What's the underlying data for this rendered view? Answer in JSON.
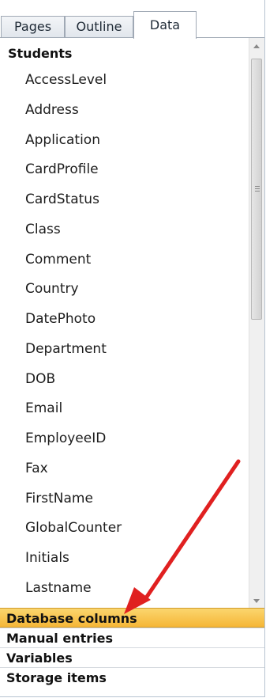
{
  "tabs": [
    {
      "label": "Pages"
    },
    {
      "label": "Outline"
    },
    {
      "label": "Data"
    }
  ],
  "active_tab": "Data",
  "tree": {
    "header": "Students",
    "items": [
      "AccessLevel",
      "Address",
      "Application",
      "CardProfile",
      "CardStatus",
      "Class",
      "Comment",
      "Country",
      "DatePhoto",
      "Department",
      "DOB",
      "Email",
      "EmployeeID",
      "Fax",
      "FirstName",
      "GlobalCounter",
      "Initials",
      "Lastname"
    ]
  },
  "sections": [
    {
      "label": "Database columns",
      "selected": true
    },
    {
      "label": "Manual entries",
      "selected": false
    },
    {
      "label": "Variables",
      "selected": false
    },
    {
      "label": "Storage items",
      "selected": false
    }
  ],
  "colors": {
    "selected_section": "#f5b637",
    "annotation_arrow": "#e02020"
  },
  "icons": [
    "scroll-up-arrow-icon",
    "scroll-down-arrow-icon",
    "scroll-grip-icon",
    "annotation-arrow-icon"
  ]
}
